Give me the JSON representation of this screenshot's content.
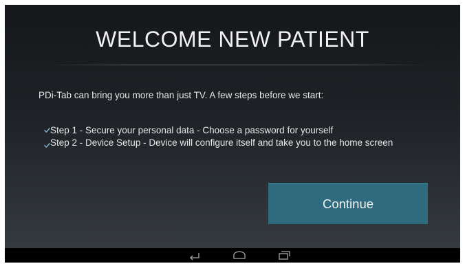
{
  "dialog": {
    "title": "WELCOME NEW PATIENT",
    "intro": "PDi-Tab can bring you more than just TV. A few steps before we start:",
    "steps": [
      {
        "label": "Step 1 - Secure your personal data - Choose a password for yourself",
        "checked": true
      },
      {
        "label": "Step 2 - Device Setup - Device will configure itself and take you to the home screen",
        "checked": true
      }
    ],
    "continue_label": "Continue"
  },
  "navbar": {
    "icons": [
      "back-icon",
      "home-icon",
      "recent-apps-icon"
    ]
  },
  "colors": {
    "accent": "#2f6b7f",
    "check": "#7aa7c2",
    "background_top": "#15171a",
    "background_bottom": "#353a3f"
  }
}
